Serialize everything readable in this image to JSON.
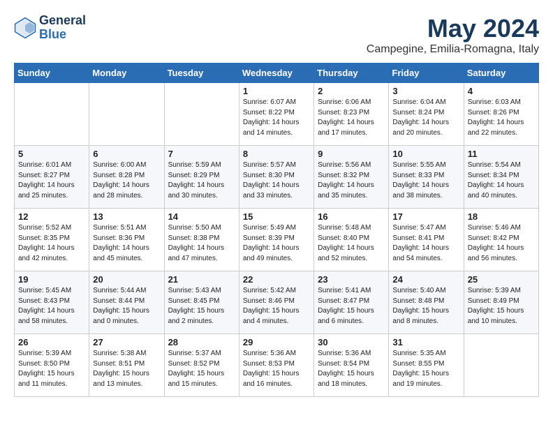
{
  "header": {
    "logo_line1": "General",
    "logo_line2": "Blue",
    "title": "May 2024",
    "subtitle": "Campegine, Emilia-Romagna, Italy"
  },
  "days_of_week": [
    "Sunday",
    "Monday",
    "Tuesday",
    "Wednesday",
    "Thursday",
    "Friday",
    "Saturday"
  ],
  "weeks": [
    [
      {
        "num": "",
        "info": ""
      },
      {
        "num": "",
        "info": ""
      },
      {
        "num": "",
        "info": ""
      },
      {
        "num": "1",
        "info": "Sunrise: 6:07 AM\nSunset: 8:22 PM\nDaylight: 14 hours\nand 14 minutes."
      },
      {
        "num": "2",
        "info": "Sunrise: 6:06 AM\nSunset: 8:23 PM\nDaylight: 14 hours\nand 17 minutes."
      },
      {
        "num": "3",
        "info": "Sunrise: 6:04 AM\nSunset: 8:24 PM\nDaylight: 14 hours\nand 20 minutes."
      },
      {
        "num": "4",
        "info": "Sunrise: 6:03 AM\nSunset: 8:26 PM\nDaylight: 14 hours\nand 22 minutes."
      }
    ],
    [
      {
        "num": "5",
        "info": "Sunrise: 6:01 AM\nSunset: 8:27 PM\nDaylight: 14 hours\nand 25 minutes."
      },
      {
        "num": "6",
        "info": "Sunrise: 6:00 AM\nSunset: 8:28 PM\nDaylight: 14 hours\nand 28 minutes."
      },
      {
        "num": "7",
        "info": "Sunrise: 5:59 AM\nSunset: 8:29 PM\nDaylight: 14 hours\nand 30 minutes."
      },
      {
        "num": "8",
        "info": "Sunrise: 5:57 AM\nSunset: 8:30 PM\nDaylight: 14 hours\nand 33 minutes."
      },
      {
        "num": "9",
        "info": "Sunrise: 5:56 AM\nSunset: 8:32 PM\nDaylight: 14 hours\nand 35 minutes."
      },
      {
        "num": "10",
        "info": "Sunrise: 5:55 AM\nSunset: 8:33 PM\nDaylight: 14 hours\nand 38 minutes."
      },
      {
        "num": "11",
        "info": "Sunrise: 5:54 AM\nSunset: 8:34 PM\nDaylight: 14 hours\nand 40 minutes."
      }
    ],
    [
      {
        "num": "12",
        "info": "Sunrise: 5:52 AM\nSunset: 8:35 PM\nDaylight: 14 hours\nand 42 minutes."
      },
      {
        "num": "13",
        "info": "Sunrise: 5:51 AM\nSunset: 8:36 PM\nDaylight: 14 hours\nand 45 minutes."
      },
      {
        "num": "14",
        "info": "Sunrise: 5:50 AM\nSunset: 8:38 PM\nDaylight: 14 hours\nand 47 minutes."
      },
      {
        "num": "15",
        "info": "Sunrise: 5:49 AM\nSunset: 8:39 PM\nDaylight: 14 hours\nand 49 minutes."
      },
      {
        "num": "16",
        "info": "Sunrise: 5:48 AM\nSunset: 8:40 PM\nDaylight: 14 hours\nand 52 minutes."
      },
      {
        "num": "17",
        "info": "Sunrise: 5:47 AM\nSunset: 8:41 PM\nDaylight: 14 hours\nand 54 minutes."
      },
      {
        "num": "18",
        "info": "Sunrise: 5:46 AM\nSunset: 8:42 PM\nDaylight: 14 hours\nand 56 minutes."
      }
    ],
    [
      {
        "num": "19",
        "info": "Sunrise: 5:45 AM\nSunset: 8:43 PM\nDaylight: 14 hours\nand 58 minutes."
      },
      {
        "num": "20",
        "info": "Sunrise: 5:44 AM\nSunset: 8:44 PM\nDaylight: 15 hours\nand 0 minutes."
      },
      {
        "num": "21",
        "info": "Sunrise: 5:43 AM\nSunset: 8:45 PM\nDaylight: 15 hours\nand 2 minutes."
      },
      {
        "num": "22",
        "info": "Sunrise: 5:42 AM\nSunset: 8:46 PM\nDaylight: 15 hours\nand 4 minutes."
      },
      {
        "num": "23",
        "info": "Sunrise: 5:41 AM\nSunset: 8:47 PM\nDaylight: 15 hours\nand 6 minutes."
      },
      {
        "num": "24",
        "info": "Sunrise: 5:40 AM\nSunset: 8:48 PM\nDaylight: 15 hours\nand 8 minutes."
      },
      {
        "num": "25",
        "info": "Sunrise: 5:39 AM\nSunset: 8:49 PM\nDaylight: 15 hours\nand 10 minutes."
      }
    ],
    [
      {
        "num": "26",
        "info": "Sunrise: 5:39 AM\nSunset: 8:50 PM\nDaylight: 15 hours\nand 11 minutes."
      },
      {
        "num": "27",
        "info": "Sunrise: 5:38 AM\nSunset: 8:51 PM\nDaylight: 15 hours\nand 13 minutes."
      },
      {
        "num": "28",
        "info": "Sunrise: 5:37 AM\nSunset: 8:52 PM\nDaylight: 15 hours\nand 15 minutes."
      },
      {
        "num": "29",
        "info": "Sunrise: 5:36 AM\nSunset: 8:53 PM\nDaylight: 15 hours\nand 16 minutes."
      },
      {
        "num": "30",
        "info": "Sunrise: 5:36 AM\nSunset: 8:54 PM\nDaylight: 15 hours\nand 18 minutes."
      },
      {
        "num": "31",
        "info": "Sunrise: 5:35 AM\nSunset: 8:55 PM\nDaylight: 15 hours\nand 19 minutes."
      },
      {
        "num": "",
        "info": ""
      }
    ]
  ]
}
